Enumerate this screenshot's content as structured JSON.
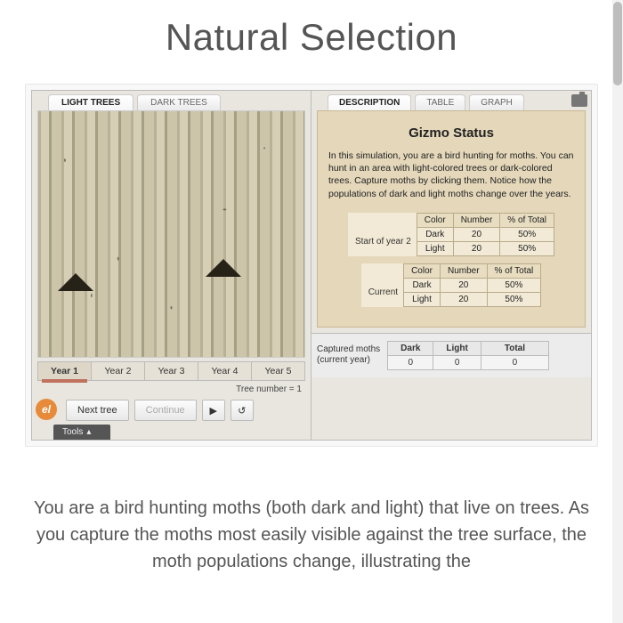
{
  "title": "Natural Selection",
  "left": {
    "tabs": [
      "LIGHT TREES",
      "DARK TREES"
    ],
    "active_tab": 0,
    "years": [
      "Year 1",
      "Year 2",
      "Year 3",
      "Year 4",
      "Year 5"
    ],
    "selected_year": 0,
    "tree_number_label": "Tree number = 1",
    "buttons": {
      "next_tree": "Next tree",
      "continue": "Continue"
    },
    "tools_label": "Tools"
  },
  "right": {
    "tabs": [
      "DESCRIPTION",
      "TABLE",
      "GRAPH"
    ],
    "active_tab": 0,
    "status_title": "Gizmo Status",
    "status_text": "In this simulation, you are a bird hunting for moths. You can hunt in an area with light-colored trees or dark-colored trees. Capture moths by clicking them. Notice how the populations of dark and light moths change over the years.",
    "table1": {
      "label": "Start of year 2",
      "headers": [
        "Color",
        "Number",
        "% of Total"
      ],
      "rows": [
        {
          "color": "Dark",
          "number": "20",
          "pct": "50%"
        },
        {
          "color": "Light",
          "number": "20",
          "pct": "50%"
        }
      ]
    },
    "table2": {
      "label": "Current",
      "headers": [
        "Color",
        "Number",
        "% of Total"
      ],
      "rows": [
        {
          "color": "Dark",
          "number": "20",
          "pct": "50%"
        },
        {
          "color": "Light",
          "number": "20",
          "pct": "50%"
        }
      ]
    },
    "captured": {
      "label_line1": "Captured moths",
      "label_line2": "(current year)",
      "headers": [
        "Dark",
        "Light",
        "Total"
      ],
      "values": [
        "0",
        "0",
        "0"
      ]
    }
  },
  "body_text": "You are a bird hunting moths (both dark and light) that live on trees. As you capture the moths most easily visible against the tree surface, the moth populations change, illustrating the"
}
